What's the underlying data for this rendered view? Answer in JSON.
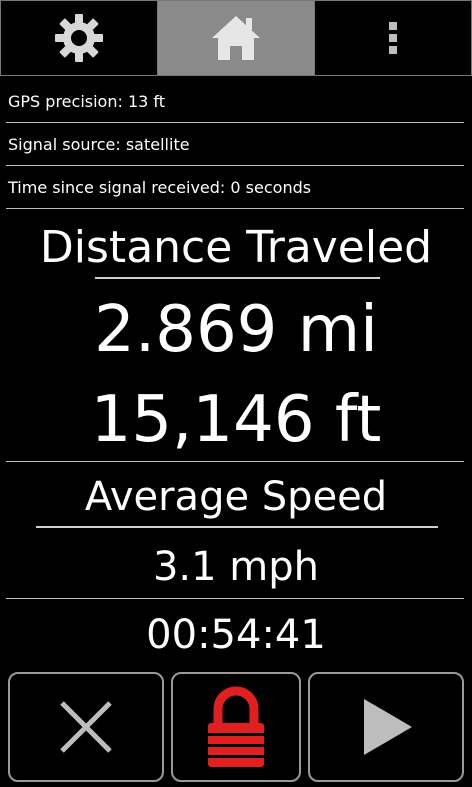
{
  "tabs": [
    {
      "icon": "gear-icon",
      "active": false
    },
    {
      "icon": "home-icon",
      "active": true
    },
    {
      "icon": "more-vertical-icon",
      "active": false
    }
  ],
  "status": {
    "gps_precision": "GPS precision: 13 ft",
    "signal_source": "Signal source: satellite",
    "time_since_signal": "Time since signal received: 0 seconds"
  },
  "distance": {
    "title": "Distance Traveled",
    "miles": "2.869 mi",
    "feet": "15,146 ft"
  },
  "speed": {
    "title": "Average Speed",
    "value": "3.1 mph"
  },
  "elapsed_time": "00:54:41",
  "buttons": [
    {
      "icon": "close-icon"
    },
    {
      "icon": "lock-icon",
      "color": "#e02020"
    },
    {
      "icon": "play-icon"
    }
  ]
}
